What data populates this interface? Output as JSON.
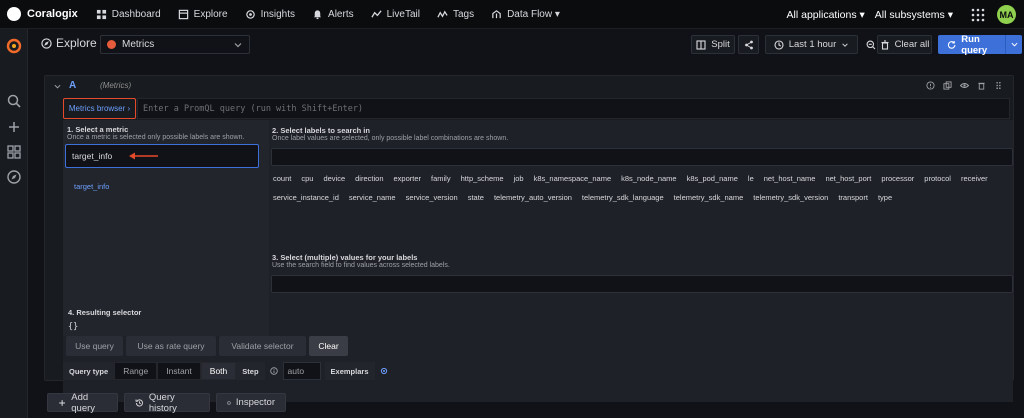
{
  "nav": {
    "brand": "Coralogix",
    "items": [
      {
        "label": "Dashboard",
        "icon": "dashboard-icon"
      },
      {
        "label": "Explore",
        "icon": "explore-icon"
      },
      {
        "label": "Insights",
        "icon": "insights-icon"
      },
      {
        "label": "Alerts",
        "icon": "bell-icon"
      },
      {
        "label": "LiveTail",
        "icon": "livetail-icon"
      },
      {
        "label": "Tags",
        "icon": "tags-icon"
      },
      {
        "label": "Data Flow ▾",
        "icon": "dataflow-icon"
      }
    ],
    "applications": "All applications ▾",
    "subsystems": "All subsystems ▾",
    "avatar": "MA"
  },
  "sidebar": {
    "icons": [
      "grafana-logo-icon",
      "search-icon",
      "plus-icon",
      "dashboards-icon",
      "compass-icon"
    ]
  },
  "toolbar": {
    "title": "Explore",
    "datasource": "Metrics",
    "split": "Split",
    "time_range": "Last 1 hour",
    "clear_all": "Clear all",
    "run_query": "Run query"
  },
  "query": {
    "letter": "A",
    "datasource": "(Metrics)",
    "metrics_browser": "Metrics browser ›",
    "placeholder": "Enter a PromQL query (run with Shift+Enter)"
  },
  "browser": {
    "select_metric_title": "1. Select a metric",
    "select_metric_sub": "Once a metric is selected only possible labels are shown.",
    "metric_input": "target_info",
    "metric_items": [
      "target_info"
    ],
    "labels_title": "2. Select labels to search in",
    "labels_sub": "Once label values are selected, only possible label combinations are shown.",
    "labels_row1": [
      "count",
      "cpu",
      "device",
      "direction",
      "exporter",
      "family",
      "http_scheme",
      "job",
      "k8s_namespace_name",
      "k8s_node_name",
      "k8s_pod_name",
      "le",
      "net_host_name",
      "net_host_port",
      "processor",
      "protocol",
      "receiver"
    ],
    "labels_row2": [
      "service_instance_id",
      "service_name",
      "service_version",
      "state",
      "telemetry_auto_version",
      "telemetry_sdk_language",
      "telemetry_sdk_name",
      "telemetry_sdk_version",
      "transport",
      "type"
    ],
    "values_title": "3. Select (multiple) values for your labels",
    "values_sub": "Use the search field to find values across selected labels.",
    "result_title": "4. Resulting selector",
    "result_value": "{}",
    "actions": [
      "Use query",
      "Use as rate query",
      "Validate selector",
      "Clear"
    ]
  },
  "options": {
    "query_type": "Query type",
    "types": [
      "Range",
      "Instant",
      "Both"
    ],
    "active_type": "Both",
    "step": "Step",
    "step_value": "auto",
    "exemplars": "Exemplars"
  },
  "bottom": {
    "add_query": "Add query",
    "query_history": "Query history",
    "inspector": "Inspector"
  }
}
